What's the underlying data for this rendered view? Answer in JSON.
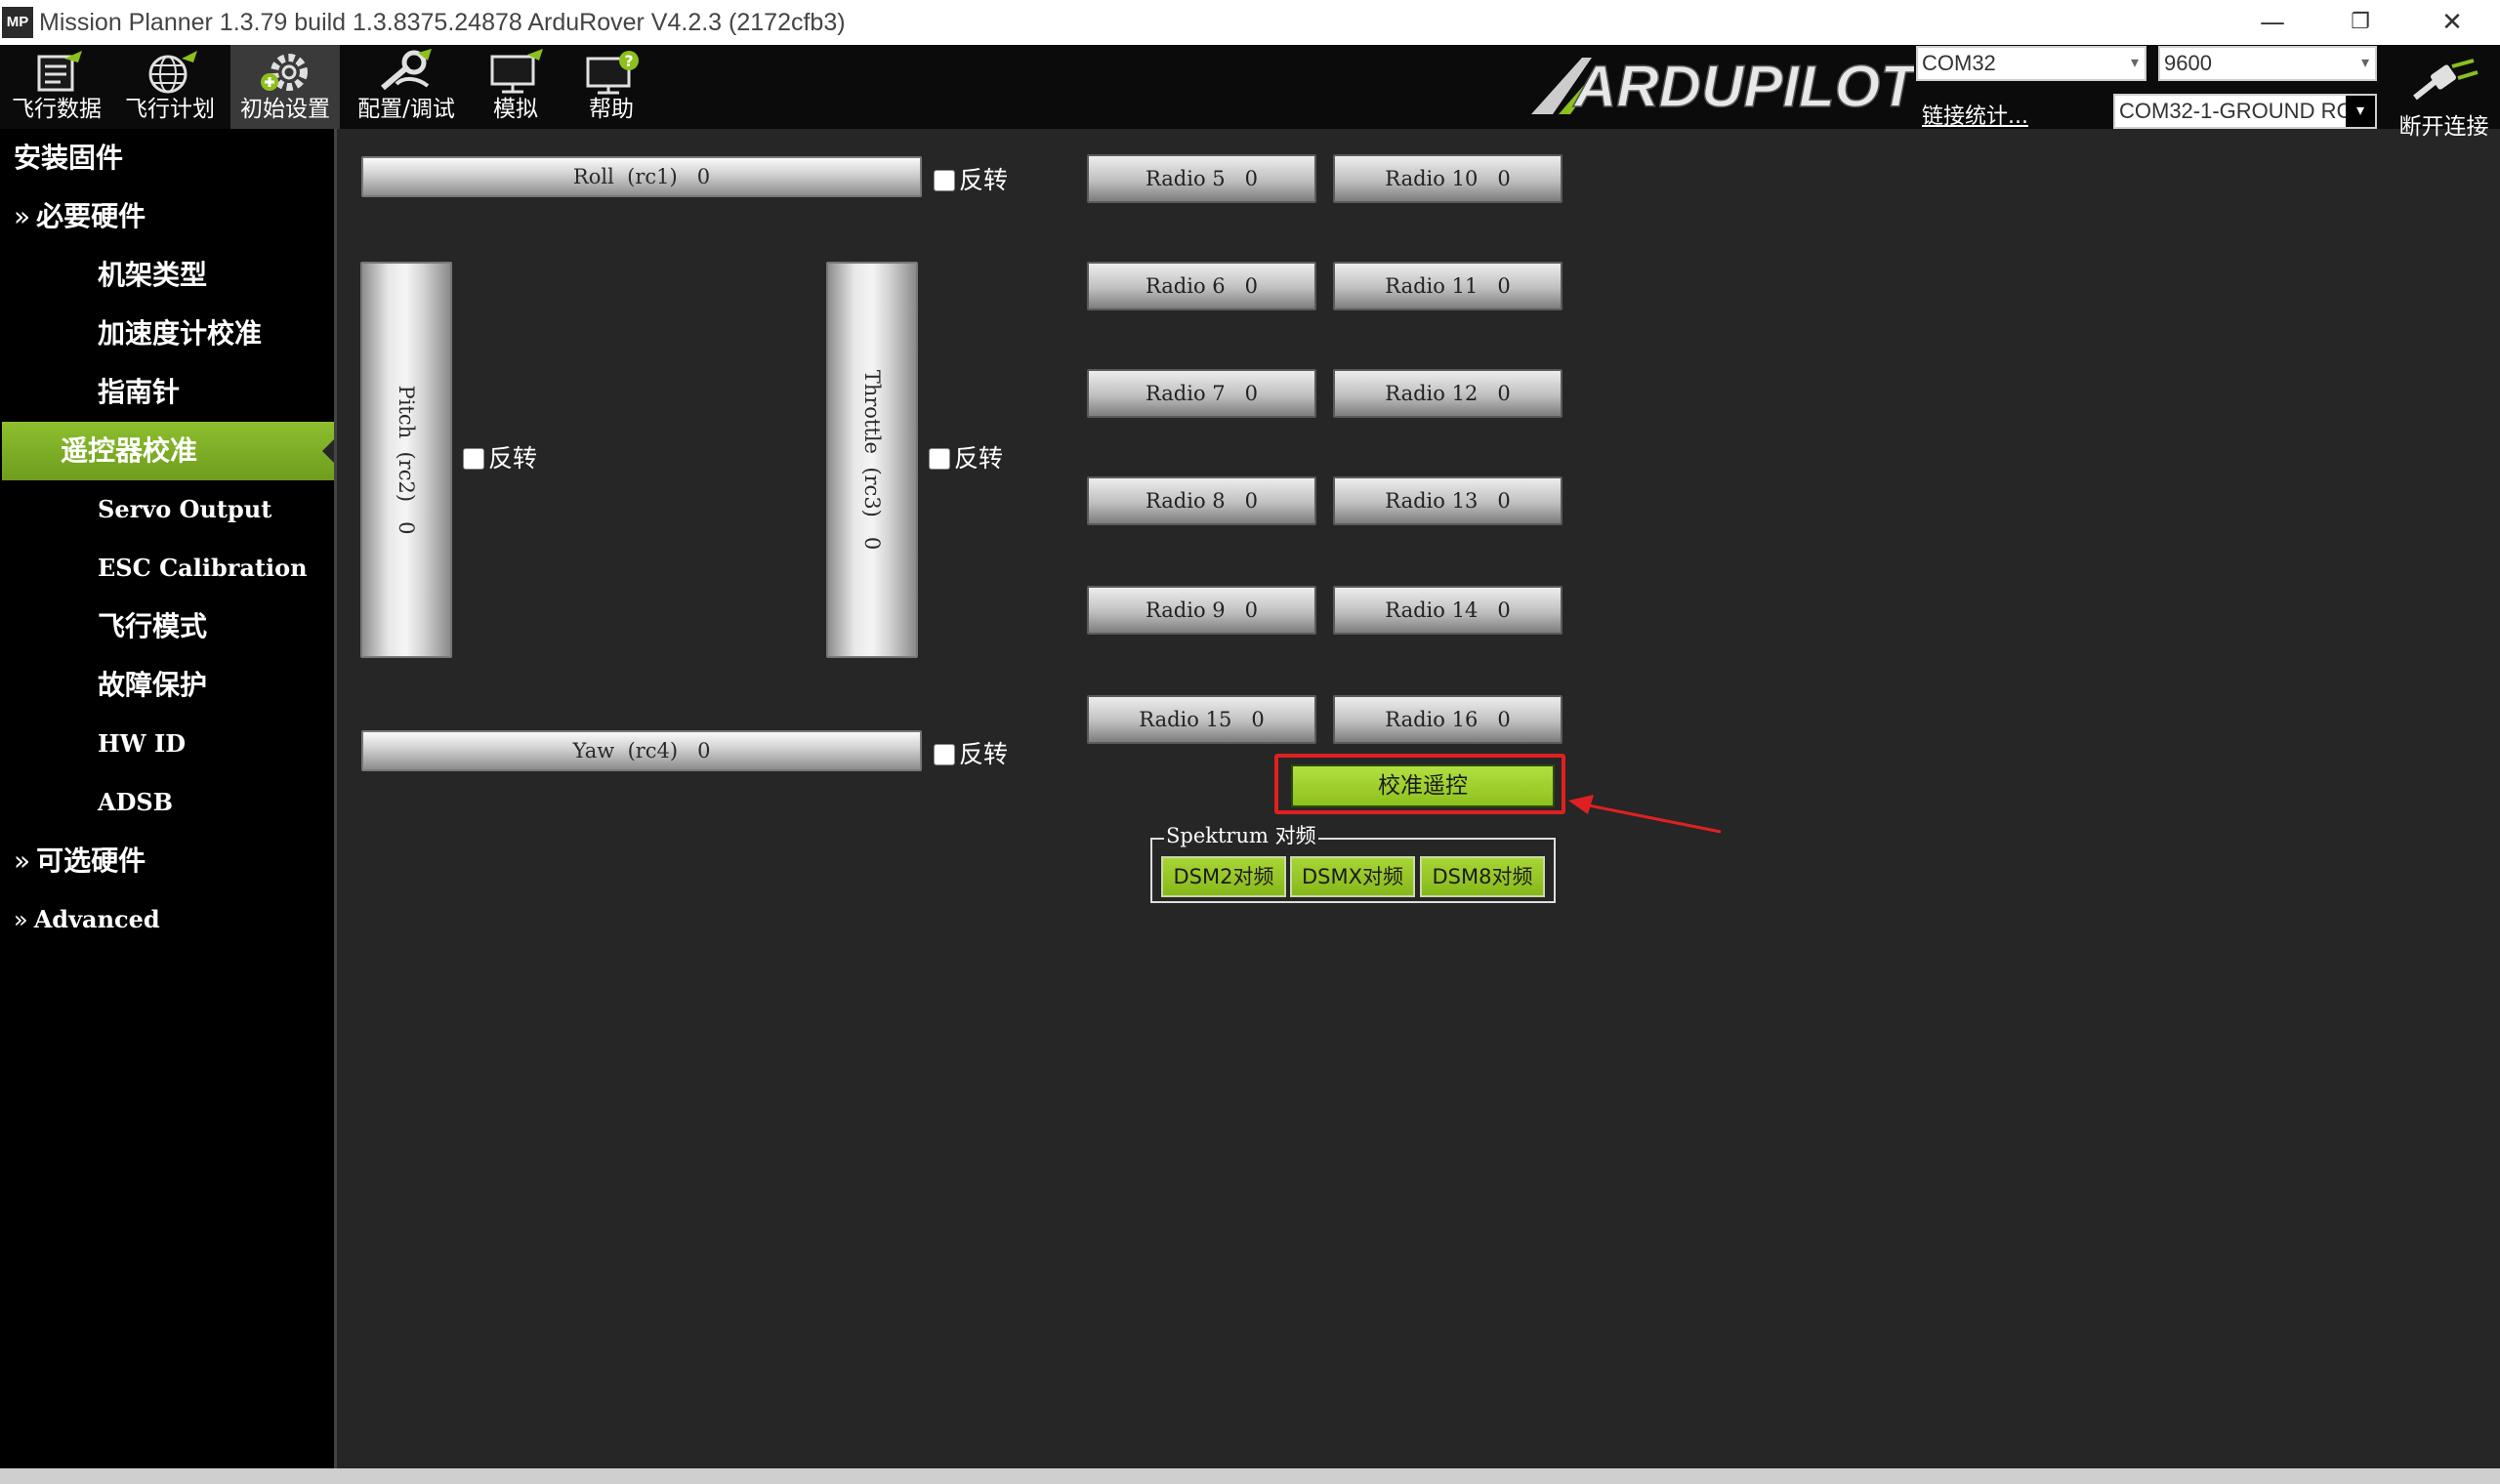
{
  "window": {
    "app_icon": "MP",
    "title": "Mission Planner 1.3.79 build 1.3.8375.24878 ArduRover V4.2.3 (2172cfb3)",
    "minimize": "—",
    "restore": "❐",
    "close": "✕"
  },
  "toolbar": {
    "items": [
      {
        "label": "飞行数据",
        "icon": "flight-data-icon"
      },
      {
        "label": "飞行计划",
        "icon": "flight-plan-icon"
      },
      {
        "label": "初始设置",
        "icon": "initial-setup-icon",
        "active": true
      },
      {
        "label": "配置/调试",
        "icon": "config-tuning-icon"
      },
      {
        "label": "模拟",
        "icon": "simulation-icon"
      },
      {
        "label": "帮助",
        "icon": "help-icon"
      }
    ],
    "logo": "ARDUPILOT",
    "port": "COM32",
    "baud": "9600",
    "link_stats": "链接统计...",
    "device": "COM32-1-GROUND RC",
    "disconnect": "断开连接"
  },
  "sidebar": {
    "items": [
      {
        "label": "安装固件",
        "type": "head"
      },
      {
        "label": "必要硬件",
        "type": "group",
        "chevron": "»"
      },
      {
        "label": "机架类型",
        "type": "sub"
      },
      {
        "label": "加速度计校准",
        "type": "sub"
      },
      {
        "label": "指南针",
        "type": "sub"
      },
      {
        "label": "遥控器校准",
        "type": "sub",
        "active": true
      },
      {
        "label": "Servo Output",
        "type": "sub"
      },
      {
        "label": "ESC Calibration",
        "type": "sub"
      },
      {
        "label": "飞行模式",
        "type": "sub"
      },
      {
        "label": "故障保护",
        "type": "sub"
      },
      {
        "label": "HW ID",
        "type": "sub"
      },
      {
        "label": "ADSB",
        "type": "sub"
      },
      {
        "label": "可选硬件",
        "type": "group",
        "chevron": "»"
      },
      {
        "label": "Advanced",
        "type": "group",
        "chevron": "»"
      }
    ]
  },
  "main": {
    "roll": "Roll  (rc1)   0",
    "pitch": "Pitch  (rc2)   0",
    "throttle": "Throttle  (rc3)   0",
    "yaw": "Yaw  (rc4)   0",
    "reverse_label": "反转",
    "radios": [
      "Radio 5   0",
      "Radio 10   0",
      "Radio 6   0",
      "Radio 11   0",
      "Radio 7   0",
      "Radio 12   0",
      "Radio 8   0",
      "Radio 13   0",
      "Radio 9   0",
      "Radio 14   0",
      "Radio 15   0",
      "Radio 16   0"
    ],
    "calibrate_button": "校准遥控",
    "spektrum": {
      "legend": "Spektrum 对频",
      "buttons": [
        "DSM2对频",
        "DSMX对频",
        "DSM8对频"
      ]
    }
  },
  "colors": {
    "accent_green": "#8cc01c",
    "highlight_red": "#e02020",
    "background": "#262626",
    "sidebar": "#000000"
  }
}
